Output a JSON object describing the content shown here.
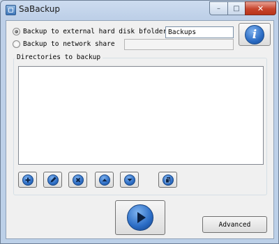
{
  "window": {
    "title": "SaBackup",
    "controls": {
      "minimize": "–",
      "maximize": "□",
      "close": "✕"
    }
  },
  "backup_options": {
    "external_drive_label": "Backup to external hard disk",
    "folder_label": "bfolder:",
    "folder_value": "Backups",
    "network_share_label": "Backup to network share",
    "network_share_value": "",
    "selected": "external_drive"
  },
  "directories": {
    "label": "Directories to backup",
    "items": []
  },
  "toolbar": {
    "buttons": [
      "add-icon",
      "edit-icon",
      "remove-icon",
      "move-up-icon",
      "move-down-icon",
      "copy-icon"
    ]
  },
  "actions": {
    "start_icon": "play-icon",
    "advanced_label": "Advanced",
    "info_icon": "info-icon",
    "info_glyph": "i"
  }
}
